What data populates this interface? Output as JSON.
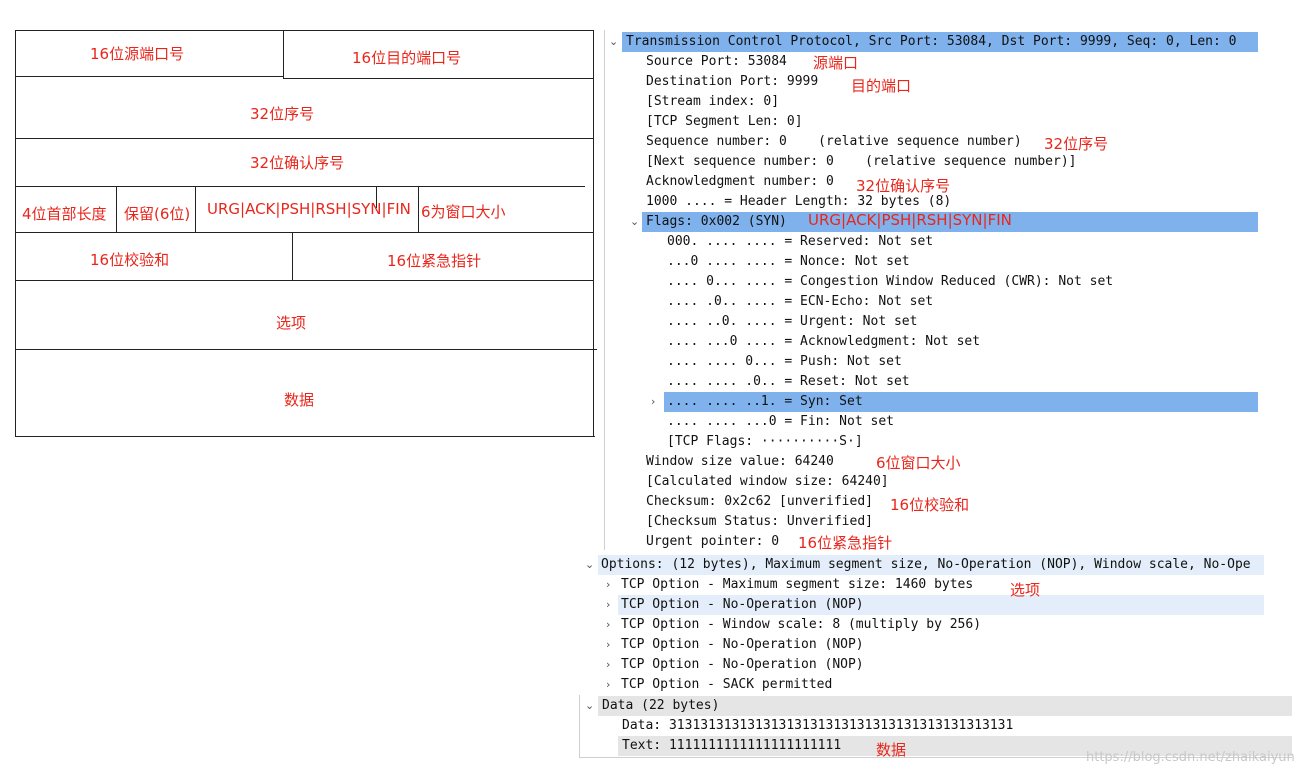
{
  "diagram": {
    "src_port": "16位源端口号",
    "dst_port": "16位目的端口号",
    "seq": "32位序号",
    "ack": "32位确认序号",
    "header_len": "4位首部长度",
    "reserved": "保留(6位)",
    "flags": "URG|ACK|PSH|RSH|SYN|FIN",
    "window": "6为窗口大小",
    "checksum": "16位校验和",
    "urgent": "16位紧急指针",
    "options": "选项",
    "data": "数据"
  },
  "tree": {
    "tcp_header": "Transmission Control Protocol, Src Port: 53084, Dst Port: 9999, Seq: 0, Len: 0",
    "src_port": "Source Port: 53084",
    "dst_port": "Destination Port: 9999",
    "stream_index": "[Stream index: 0]",
    "seg_len": "[TCP Segment Len: 0]",
    "seq": "Sequence number: 0    (relative sequence number)",
    "next_seq": "[Next sequence number: 0    (relative sequence number)]",
    "ack": "Acknowledgment number: 0",
    "header_len": "1000 .... = Header Length: 32 bytes (8)",
    "flags": "Flags: 0x002 (SYN)",
    "flag_reserved": "000. .... .... = Reserved: Not set",
    "flag_nonce": "...0 .... .... = Nonce: Not set",
    "flag_cwr": ".... 0... .... = Congestion Window Reduced (CWR): Not set",
    "flag_ecn": ".... .0.. .... = ECN-Echo: Not set",
    "flag_urg": ".... ..0. .... = Urgent: Not set",
    "flag_ack": ".... ...0 .... = Acknowledgment: Not set",
    "flag_push": ".... .... 0... = Push: Not set",
    "flag_reset": ".... .... .0.. = Reset: Not set",
    "flag_syn": ".... .... ..1. = Syn: Set",
    "flag_fin": ".... .... ...0 = Fin: Not set",
    "tcp_flags": "[TCP Flags: ··········S·]",
    "window": "Window size value: 64240",
    "calc_window": "[Calculated window size: 64240]",
    "checksum": "Checksum: 0x2c62 [unverified]",
    "checksum_status": "[Checksum Status: Unverified]",
    "urgent": "Urgent pointer: 0",
    "options": "Options: (12 bytes), Maximum segment size, No-Operation (NOP), Window scale, No-Ope",
    "opt_mss": "TCP Option - Maximum segment size: 1460 bytes",
    "opt_nop1": "TCP Option - No-Operation (NOP)",
    "opt_ws": "TCP Option - Window scale: 8 (multiply by 256)",
    "opt_nop2": "TCP Option - No-Operation (NOP)",
    "opt_nop3": "TCP Option - No-Operation (NOP)",
    "opt_sack": "TCP Option - SACK permitted",
    "data_header": "Data (22 bytes)",
    "data_hex": "Data: 31313131313131313131313131313131313131313131",
    "data_text": "Text: 1111111111111111111111"
  },
  "notes": {
    "src_port": "源端口",
    "dst_port": "目的端口",
    "seq": "32位序号",
    "ack": "32位确认序号",
    "flags": "URG|ACK|PSH|RSH|SYN|FIN",
    "window": "6位窗口大小",
    "checksum": "16位校验和",
    "urgent": "16位紧急指针",
    "options": "选项",
    "data": "数据"
  },
  "watermark": "https://blog.csdn.net/zhaikaiyun",
  "colors": {
    "selected": "#7fb2ec",
    "hover": "#e3eefa",
    "data_row": "#e5e5e5",
    "annotation": "#e8261c"
  }
}
